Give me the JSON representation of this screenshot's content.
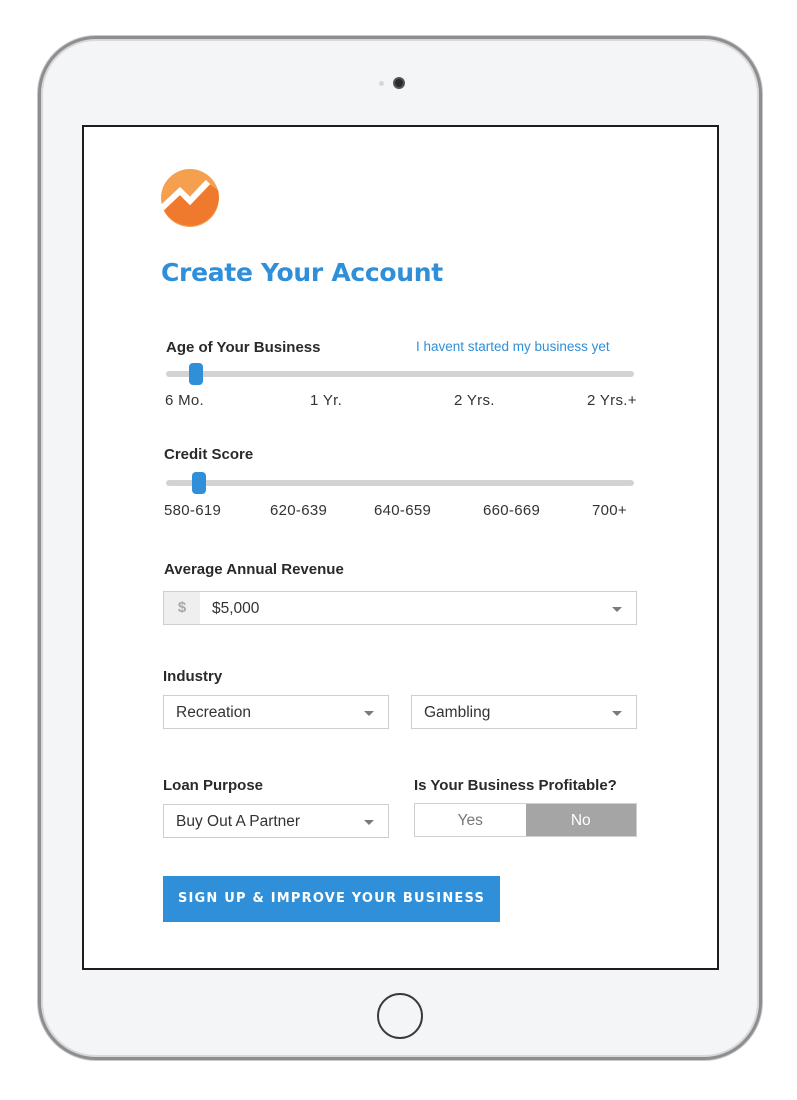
{
  "title": "Create Your Account",
  "colors": {
    "accent": "#2f8fd8",
    "logo_light": "#f4a04f",
    "logo_dark": "#ef7a2d",
    "toggle_active": "#a5a5a5"
  },
  "business_age": {
    "label": "Age of Your Business",
    "link": "I havent started my business yet",
    "ticks": [
      "6 Mo.",
      "1 Yr.",
      "2 Yrs.",
      "2 Yrs.+"
    ],
    "selected_index": 0
  },
  "credit_score": {
    "label": "Credit Score",
    "ticks": [
      "580-619",
      "620-639",
      "640-659",
      "660-669",
      "700+"
    ],
    "selected_index": 0
  },
  "revenue": {
    "label": "Average Annual Revenue",
    "currency_symbol": "$",
    "value": "$5,000"
  },
  "industry": {
    "label": "Industry",
    "category": "Recreation",
    "subcategory": "Gambling"
  },
  "loan_purpose": {
    "label": "Loan Purpose",
    "value": "Buy Out A Partner"
  },
  "profitable": {
    "label": "Is Your Business Profitable?",
    "yes": "Yes",
    "no": "No",
    "selected": "No"
  },
  "cta": "SIGN UP & IMPROVE YOUR BUSINESS"
}
